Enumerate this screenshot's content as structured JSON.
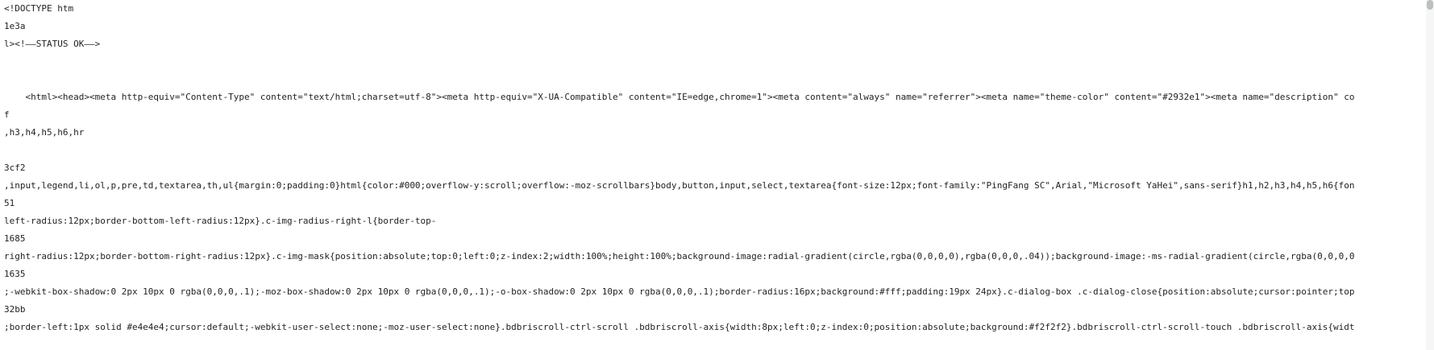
{
  "source_lines": [
    "<!DOCTYPE htm",
    "1e3a",
    "l><!——STATUS OK——>",
    "",
    "",
    "    <html><head><meta http-equiv=\"Content-Type\" content=\"text/html;charset=utf-8\"><meta http-equiv=\"X-UA-Compatible\" content=\"IE=edge,chrome=1\"><meta content=\"always\" name=\"referrer\"><meta name=\"theme-color\" content=\"#2932e1\"><meta name=\"description\" co",
    "f",
    ",h3,h4,h5,h6,hr",
    "",
    "3cf2",
    ",input,legend,li,ol,p,pre,td,textarea,th,ul{margin:0;padding:0}html{color:#000;overflow-y:scroll;overflow:-moz-scrollbars}body,button,input,select,textarea{font-size:12px;font-family:\"PingFang SC\",Arial,\"Microsoft YaHei\",sans-serif}h1,h2,h3,h4,h5,h6{fon",
    "51",
    "left-radius:12px;border-bottom-left-radius:12px}.c-img-radius-right-l{border-top-",
    "1685",
    "right-radius:12px;border-bottom-right-radius:12px}.c-img-mask{position:absolute;top:0;left:0;z-index:2;width:100%;height:100%;background-image:radial-gradient(circle,rgba(0,0,0,0),rgba(0,0,0,.04));background-image:-ms-radial-gradient(circle,rgba(0,0,0,0",
    "1635",
    ";-webkit-box-shadow:0 2px 10px 0 rgba(0,0,0,.1);-moz-box-shadow:0 2px 10px 0 rgba(0,0,0,.1);-o-box-shadow:0 2px 10px 0 rgba(0,0,0,.1);border-radius:16px;background:#fff;padding:19px 24px}.c-dialog-box .c-dialog-close{position:absolute;cursor:pointer;top",
    "32bb",
    ";border-left:1px solid #e4e4e4;cursor:default;-webkit-user-select:none;-moz-user-select:none}.bdbriscroll-ctrl-scroll .bdbriscroll-axis{width:8px;left:0;z-index:0;position:absolute;background:#f2f2f2}.bdbriscroll-ctrl-scroll-touch .bdbriscroll-axis{widt"
  ]
}
